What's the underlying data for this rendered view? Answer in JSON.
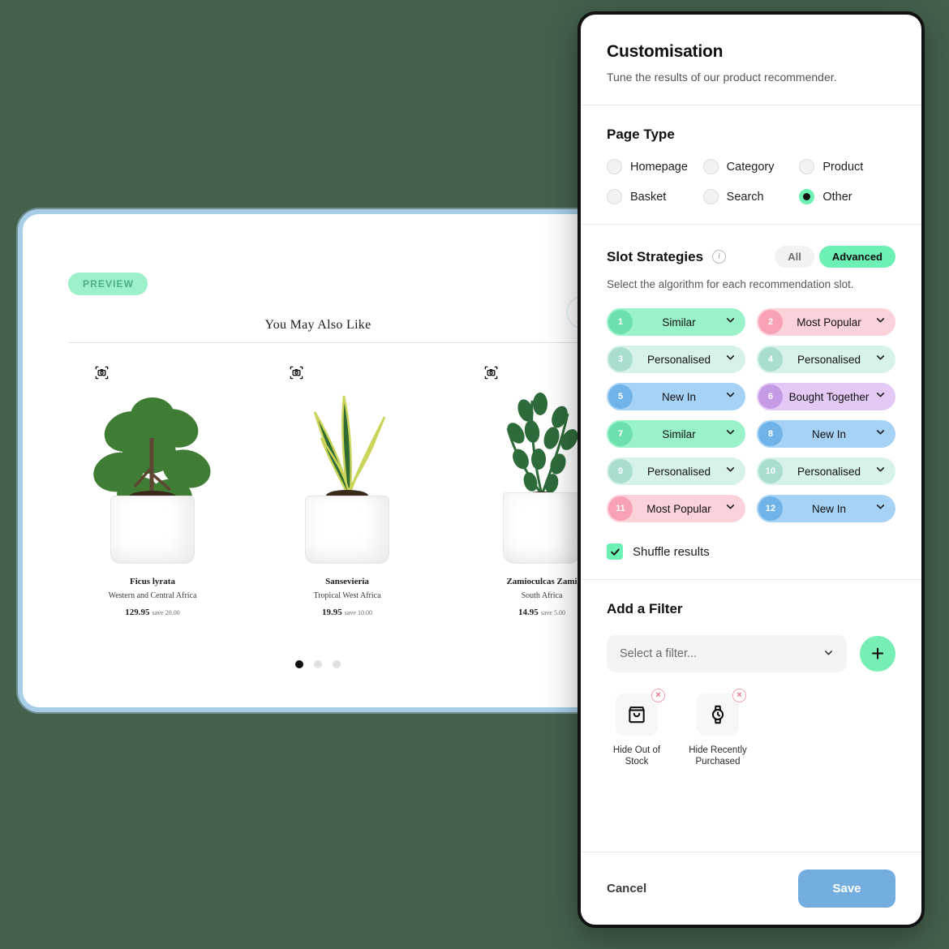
{
  "preview": {
    "badge": "PREVIEW",
    "rec_title": "You May Also Like",
    "products": [
      {
        "name": "Ficus lyrata",
        "origin": "Western and Central Africa",
        "price": "129.95",
        "save": "save 20.00",
        "icon": "camera-icon"
      },
      {
        "name": "Sansevieria",
        "origin": "Tropical West Africa",
        "price": "19.95",
        "save": "save 10.00",
        "icon": "camera-icon"
      },
      {
        "name": "Zamioculcas Zami",
        "origin": "South Africa",
        "price": "14.95",
        "save": "save 5.00",
        "icon": "camera-icon"
      }
    ],
    "pagination": {
      "total": 3,
      "active": 1
    }
  },
  "modal": {
    "title": "Customisation",
    "subtitle": "Tune the results of our product recommender.",
    "page_type": {
      "heading": "Page Type",
      "options": [
        {
          "label": "Homepage",
          "selected": false
        },
        {
          "label": "Category",
          "selected": false
        },
        {
          "label": "Product",
          "selected": false
        },
        {
          "label": "Basket",
          "selected": false
        },
        {
          "label": "Search",
          "selected": false
        },
        {
          "label": "Other",
          "selected": true
        }
      ]
    },
    "slot_strategies": {
      "heading": "Slot Strategies",
      "info_icon": "info-icon",
      "description": "Select the algorithm for each recommendation slot.",
      "toggle": {
        "all": "All",
        "advanced": "Advanced",
        "active": "Advanced"
      },
      "slots": [
        {
          "num": "1",
          "label": "Similar",
          "theme": "s-similar"
        },
        {
          "num": "2",
          "label": "Most Popular",
          "theme": "s-popular"
        },
        {
          "num": "3",
          "label": "Personalised",
          "theme": "s-personal"
        },
        {
          "num": "4",
          "label": "Personalised",
          "theme": "s-personal"
        },
        {
          "num": "5",
          "label": "New In",
          "theme": "s-newin"
        },
        {
          "num": "6",
          "label": "Bought Together",
          "theme": "s-bought"
        },
        {
          "num": "7",
          "label": "Similar",
          "theme": "s-similar"
        },
        {
          "num": "8",
          "label": "New In",
          "theme": "s-newin"
        },
        {
          "num": "9",
          "label": "Personalised",
          "theme": "s-personal"
        },
        {
          "num": "10",
          "label": "Personalised",
          "theme": "s-personal"
        },
        {
          "num": "11",
          "label": "Most Popular",
          "theme": "s-popular"
        },
        {
          "num": "12",
          "label": "New In",
          "theme": "s-newin"
        }
      ],
      "shuffle": {
        "label": "Shuffle results",
        "checked": true
      }
    },
    "add_filter": {
      "heading": "Add a Filter",
      "select_placeholder": "Select a filter...",
      "add_button": "+",
      "chips": [
        {
          "label": "Hide Out of Stock",
          "icon": "shopping-bag-icon",
          "remove": "×"
        },
        {
          "label": "Hide Recently Purchased",
          "icon": "watch-icon",
          "remove": "×"
        }
      ]
    },
    "footer": {
      "cancel": "Cancel",
      "save": "Save"
    }
  },
  "colors": {
    "accent_green": "#6cf0b4",
    "save_blue": "#74aede",
    "panel_border": "#a9cfe8",
    "backdrop": "#44614c"
  }
}
